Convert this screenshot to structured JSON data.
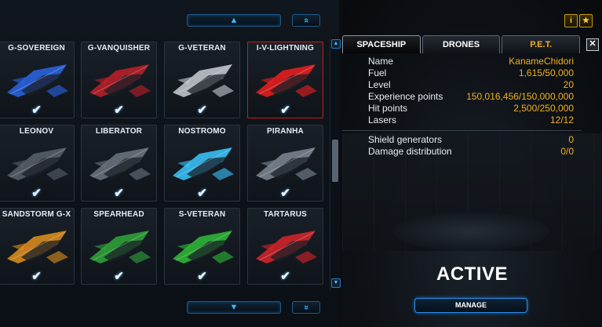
{
  "grid_nav": {
    "up_arrow": "▲",
    "down_arrow": "▼",
    "jump_top": "«",
    "jump_bottom": "»",
    "scroll_up": "▲",
    "scroll_down": "▼"
  },
  "ships": [
    {
      "name": "G-SOVEREIGN",
      "color": "#2a66e8",
      "checked": "✔"
    },
    {
      "name": "G-VANQUISHER",
      "color": "#c0202a",
      "checked": "✔"
    },
    {
      "name": "G-VETERAN",
      "color": "#c9ced4",
      "checked": "✔"
    },
    {
      "name": "I-V-LIGHTNING",
      "color": "#ee1f1f",
      "checked": "✔"
    },
    {
      "name": "LEONOV",
      "color": "#59616a",
      "checked": "✔"
    },
    {
      "name": "LIBERATOR",
      "color": "#6d7680",
      "checked": "✔"
    },
    {
      "name": "NOSTROMO",
      "color": "#3ac8ff",
      "checked": "✔"
    },
    {
      "name": "PIRANHA",
      "color": "#7f8893",
      "checked": "✔"
    },
    {
      "name": "SANDSTORM G-X",
      "color": "#e3901c",
      "checked": "✔"
    },
    {
      "name": "SPEARHEAD",
      "color": "#2fa83a",
      "checked": "✔"
    },
    {
      "name": "S-VETERAN",
      "color": "#2fbd36",
      "checked": "✔"
    },
    {
      "name": "TARTARUS",
      "color": "#d9252a",
      "checked": "✔"
    }
  ],
  "corner_buttons": {
    "info": "i",
    "star": "★"
  },
  "tabs": [
    {
      "label": "SPACESHIP"
    },
    {
      "label": "DRONES"
    },
    {
      "label": "P.E.T."
    }
  ],
  "close_label": "✕",
  "stats": {
    "name": {
      "label": "Name",
      "value": "KanameChidori"
    },
    "fuel": {
      "label": "Fuel",
      "value": "1,615/50,000"
    },
    "level": {
      "label": "Level",
      "value": "20"
    },
    "experience": {
      "label": "Experience points",
      "value": "150,016,456/150,000,000"
    },
    "hit_points": {
      "label": "Hit points",
      "value": "2,500/250,000"
    },
    "lasers": {
      "label": "Lasers",
      "value": "12/12"
    },
    "shield_generators": {
      "label": "Shield generators",
      "value": "0"
    },
    "damage_distribution": {
      "label": "Damage distribution",
      "value": "0/0"
    }
  },
  "status": "ACTIVE",
  "manage_label": "MANAGE",
  "colors": {
    "accent": "#2a8ee8",
    "value_gold": "#f2b01c"
  }
}
